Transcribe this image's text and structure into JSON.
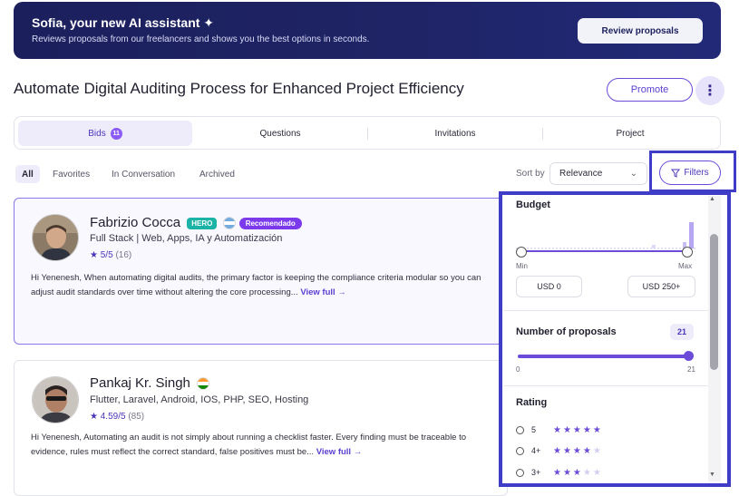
{
  "banner": {
    "title": "Sofia, your new AI assistant ✦",
    "subtitle": "Reviews proposals from our freelancers and shows you the best options in seconds.",
    "button": "Review proposals"
  },
  "project": {
    "title": "Automate Digital Auditing Process for Enhanced Project Efficiency",
    "promote_label": "Promote",
    "more_icon": "⋮"
  },
  "tabs": [
    {
      "label": "Bids",
      "badge": "11"
    },
    {
      "label": "Questions"
    },
    {
      "label": "Invitations"
    },
    {
      "label": "Project"
    }
  ],
  "filters": {
    "chips": [
      "All",
      "Favorites",
      "In Conversation",
      "Archived"
    ],
    "sort_label": "Sort by",
    "sort_value": "Relevance",
    "filters_button": "Filters"
  },
  "proposals": [
    {
      "name": "Fabrizio Cocca",
      "badges": {
        "hero": "HERO",
        "recommended": "Recomendado"
      },
      "role": "Full Stack | Web, Apps, IA y Automatización",
      "rating": "5/5",
      "reviews": "(16)",
      "description": "Hi Yenenesh, When automating digital audits, the primary factor is keeping the compliance criteria modular so you can adjust audit standards over time without altering the core processing...",
      "view_full": "View full →"
    },
    {
      "name": "Pankaj Kr. Singh",
      "role": "Flutter, Laravel, Android, IOS, PHP, SEO, Hosting",
      "rating": "4.59/5",
      "reviews": "(85)",
      "description": "Hi Yenenesh, Automating an audit is not simply about running a checklist faster. Every finding must be traceable to evidence, rules must reflect the correct standard, false positives must be...",
      "view_full": "View full →"
    }
  ],
  "panel": {
    "budget": {
      "title": "Budget",
      "min_label": "Min",
      "max_label": "Max",
      "min_value": "USD 0",
      "max_value": "USD 250+"
    },
    "proposals": {
      "title": "Number of proposals",
      "count": "21",
      "min": "0",
      "max": "21",
      "fill": 1.0
    },
    "rating": {
      "title": "Rating",
      "rows": [
        {
          "label": "5",
          "filled": 5
        },
        {
          "label": "4+",
          "filled": 4
        },
        {
          "label": "3+",
          "filled": 3
        }
      ]
    }
  },
  "colors": {
    "accent": "#6b4bd8",
    "banner": "#1b1f5c",
    "hero_badge": "#1bb3a6",
    "recommended_badge": "#7c3aed"
  }
}
